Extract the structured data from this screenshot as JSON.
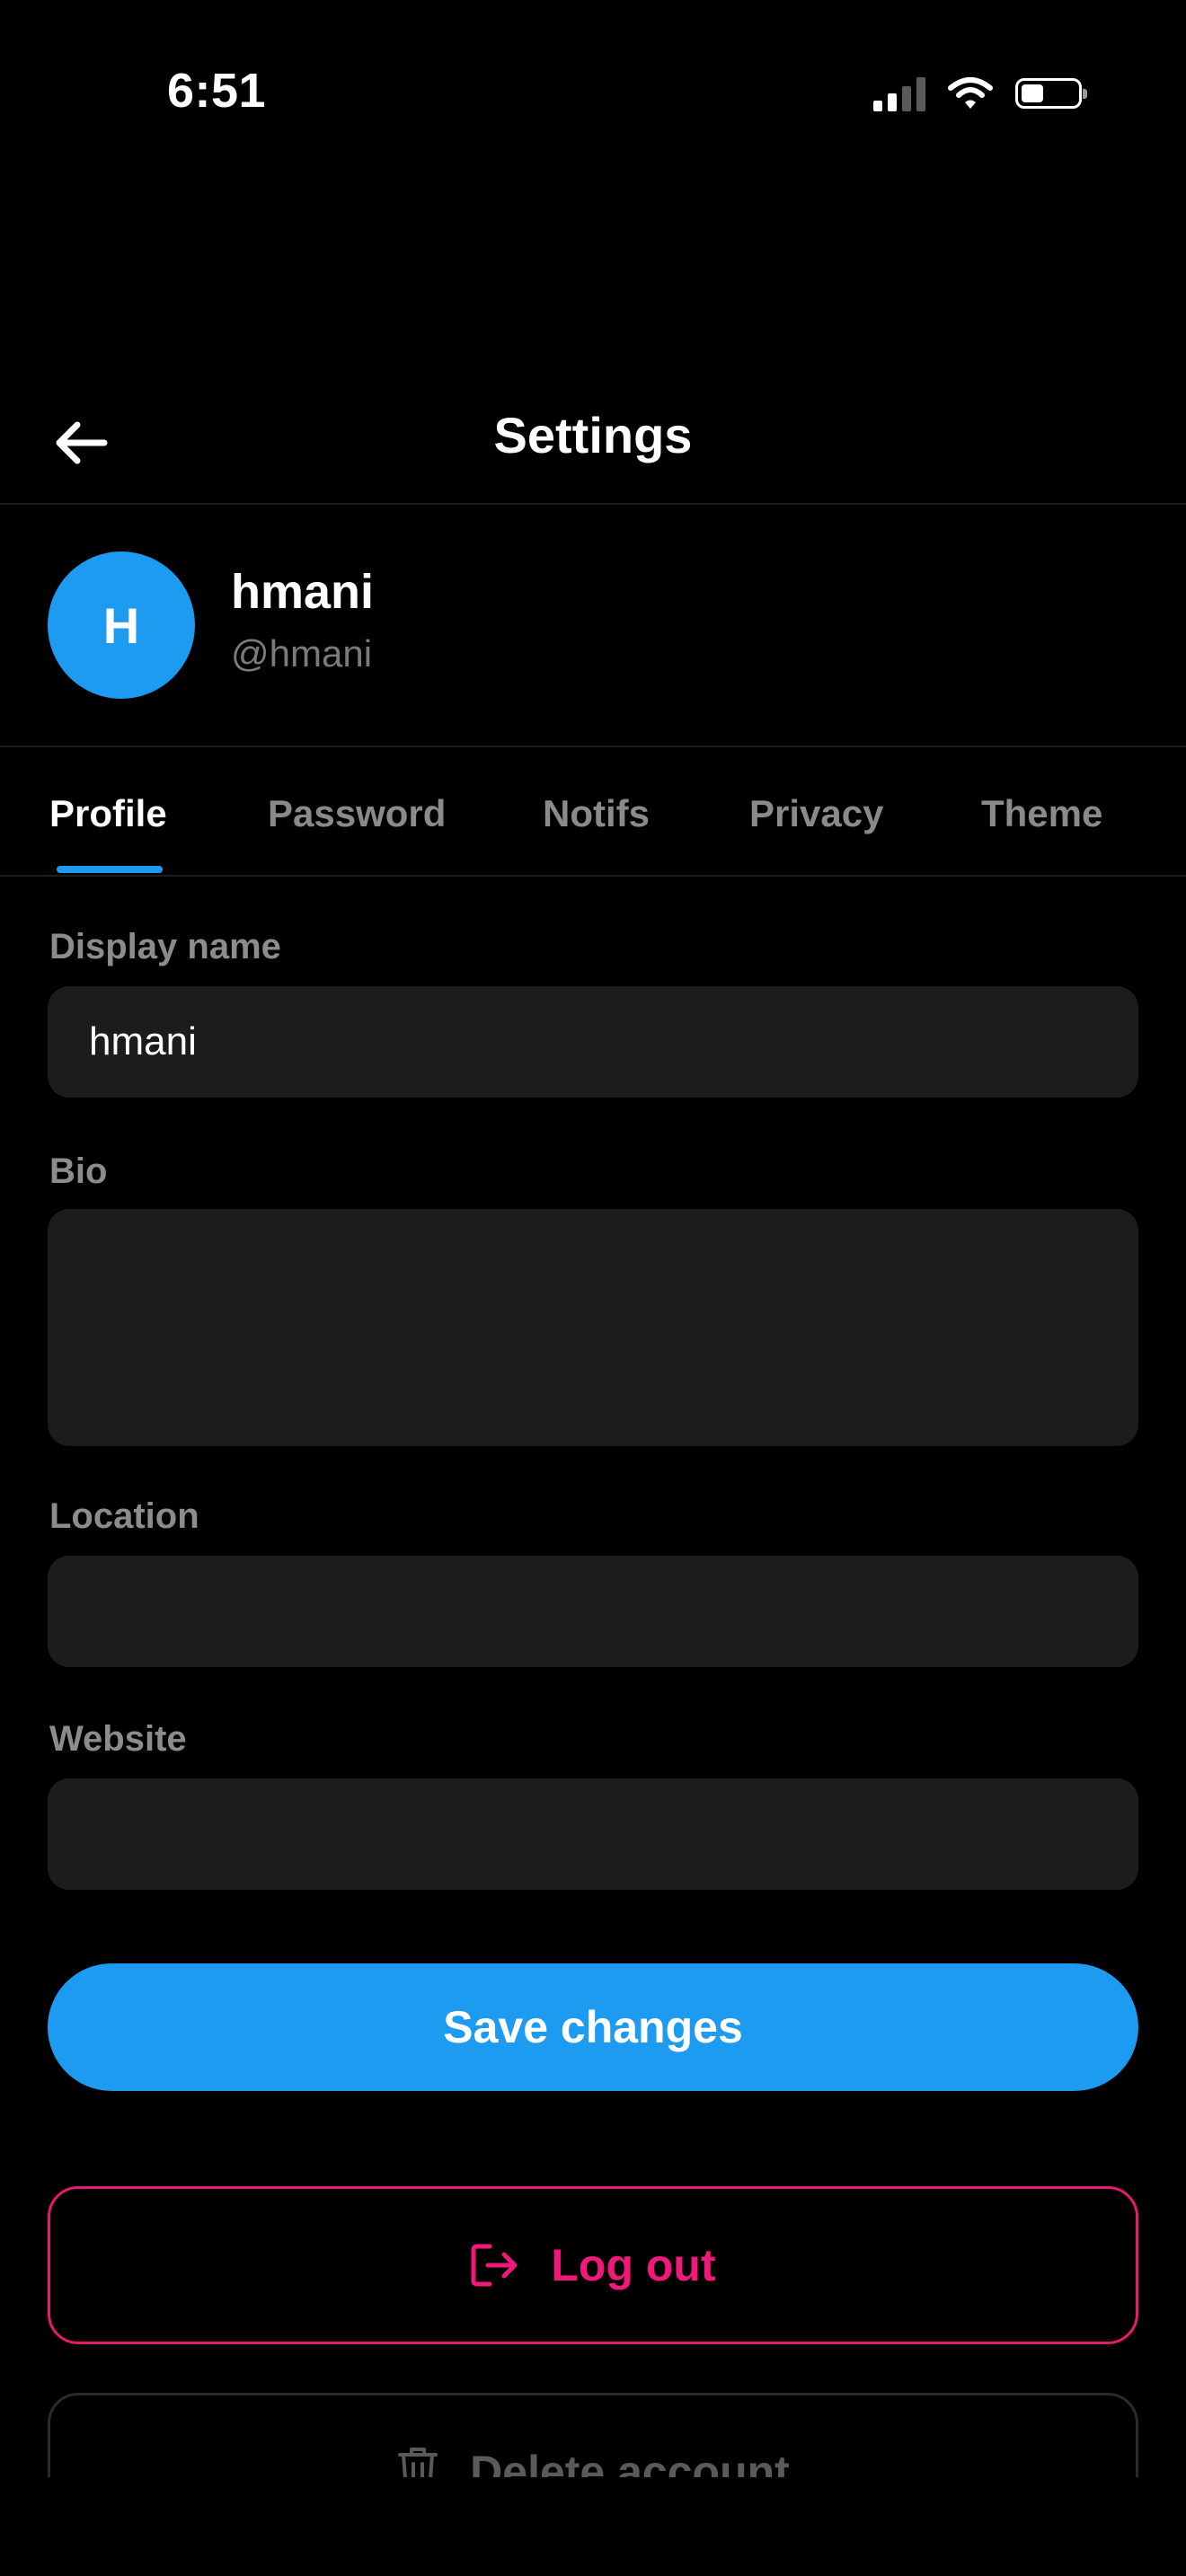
{
  "status_bar": {
    "time": "6:51"
  },
  "nav": {
    "title": "Settings",
    "back_icon": "arrow-left-icon"
  },
  "profile": {
    "avatar_initial": "H",
    "avatar_color": "#1d9bf0",
    "name": "hmani",
    "handle": "@hmani"
  },
  "tabs": [
    {
      "label": "Profile",
      "active": true
    },
    {
      "label": "Password",
      "active": false
    },
    {
      "label": "Notifs",
      "active": false
    },
    {
      "label": "Privacy",
      "active": false
    },
    {
      "label": "Theme",
      "active": false
    }
  ],
  "form": {
    "display_name": {
      "label": "Display name",
      "value": "hmani"
    },
    "bio": {
      "label": "Bio",
      "value": ""
    },
    "location": {
      "label": "Location",
      "value": ""
    },
    "website": {
      "label": "Website",
      "value": ""
    }
  },
  "actions": {
    "save_label": "Save changes",
    "logout_label": "Log out",
    "logout_icon": "logout-icon",
    "delete_label": "Delete account",
    "delete_icon": "trash-icon"
  },
  "colors": {
    "accent": "#1d9bf0",
    "danger": "#f0197a",
    "background": "#000000",
    "input_bg": "#1c1c1c"
  }
}
